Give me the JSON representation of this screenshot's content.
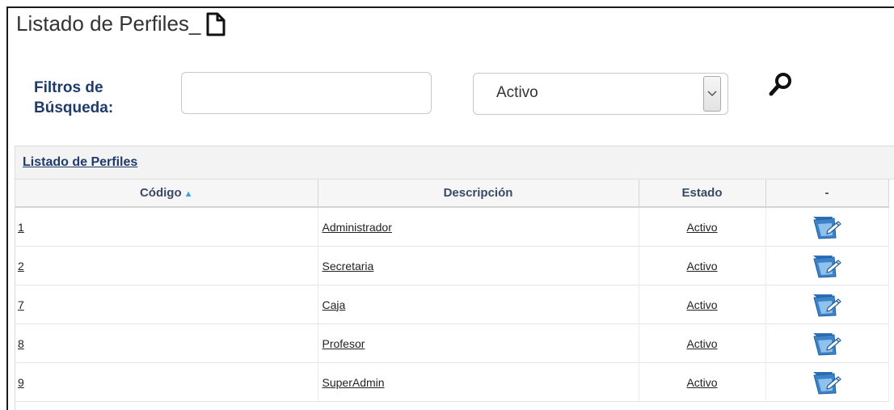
{
  "page": {
    "title": "Listado de Perfiles_"
  },
  "filters": {
    "label_line1": "Filtros de",
    "label_line2": "Búsqueda:",
    "search_value": "",
    "status_selected": "Activo"
  },
  "grid": {
    "caption": "Listado de Perfiles",
    "columns": [
      "Código",
      "Descripción",
      "Estado",
      "-"
    ],
    "rows": [
      {
        "code": "1",
        "description": "Administrador",
        "status": "Activo"
      },
      {
        "code": "2",
        "description": "Secretaria",
        "status": "Activo"
      },
      {
        "code": "7",
        "description": "Caja",
        "status": "Activo"
      },
      {
        "code": "8",
        "description": "Profesor",
        "status": "Activo"
      },
      {
        "code": "9",
        "description": "SuperAdmin",
        "status": "Activo"
      }
    ]
  },
  "icons": {
    "title": "new-document-icon",
    "search": "magnifier-icon",
    "sort": "sort-asc-icon",
    "row_action": "edit-icon",
    "select": "chevron-down-icon"
  },
  "colors": {
    "label": "#1f3b6b",
    "sort": "#3aa0e0",
    "edit_icon": "#3b83c9"
  }
}
